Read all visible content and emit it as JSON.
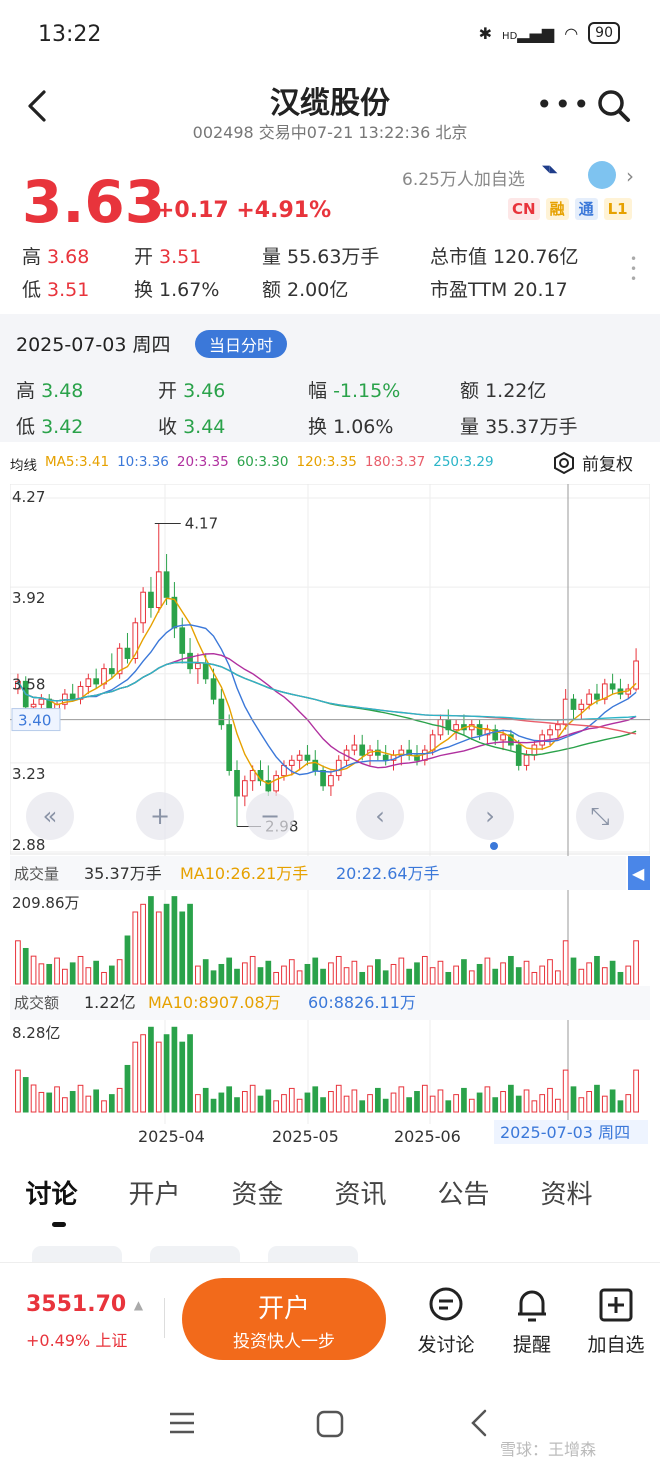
{
  "status_bar": {
    "time": "13:22",
    "network": "HD",
    "battery": "90"
  },
  "header": {
    "title": "汉缆股份",
    "subtitle": "002498 交易中07-21 13:22:36 北京",
    "more_icon": "more-dots-icon",
    "search_icon": "search-icon",
    "back_icon": "back-arrow-icon"
  },
  "quote": {
    "price": "3.63",
    "change": "+0.17 +4.91%",
    "followers": "6.25万人加自选",
    "badges": [
      {
        "label": "CN",
        "color": "#e8343c",
        "bg": "#fde7e7"
      },
      {
        "label": "融",
        "color": "#e6a100",
        "bg": "#fff3d6"
      },
      {
        "label": "通",
        "color": "#3b78d9",
        "bg": "#e5eefb"
      },
      {
        "label": "L1",
        "color": "#e6a100",
        "bg": "#fff3d6"
      }
    ],
    "stats": {
      "high_label": "高",
      "high": "3.68",
      "open_label": "开",
      "open": "3.51",
      "volume_label": "量",
      "volume": "55.63万手",
      "mktcap_label": "总市值",
      "mktcap": "120.76亿",
      "low_label": "低",
      "low": "3.51",
      "turnover_label": "换",
      "turnover": "1.67%",
      "amount_label": "额",
      "amount": "2.00亿",
      "pe_label": "市盈TTM",
      "pe": "20.17"
    }
  },
  "day_card": {
    "date": "2025-07-03 周四",
    "button": "当日分时",
    "high_label": "高",
    "high": "3.48",
    "open_label": "开",
    "open": "3.46",
    "range_label": "幅",
    "range": "-1.15%",
    "amount_label": "额",
    "amount": "1.22亿",
    "low_label": "低",
    "low": "3.42",
    "close_label": "收",
    "close": "3.44",
    "turnover_label": "换",
    "turnover": "1.06%",
    "volume_label": "量",
    "volume": "35.37万手"
  },
  "ma_row": {
    "label": "均线",
    "items": [
      {
        "text": "MA5:3.41",
        "color": "#e6a100"
      },
      {
        "text": "10:3.36",
        "color": "#3b78d9"
      },
      {
        "text": "20:3.35",
        "color": "#b0309f"
      },
      {
        "text": "60:3.30",
        "color": "#2aa24a"
      },
      {
        "text": "120:3.35",
        "color": "#e6a100"
      },
      {
        "text": "180:3.37",
        "color": "#e85d6a"
      },
      {
        "text": "250:3.29",
        "color": "#2bb5c8"
      }
    ],
    "fq_label": "前复权"
  },
  "chart_data": {
    "type": "candlestick",
    "y_ticks": [
      "4.27",
      "3.92",
      "3.58",
      "3.23",
      "2.88"
    ],
    "ylim": [
      2.88,
      4.27
    ],
    "cursor_price": "3.40",
    "max_annotation": "4.17",
    "min_annotation": "2.98",
    "x_ticks": [
      "2025-04",
      "2025-05",
      "2025-06"
    ],
    "cursor_date": "2025-07-03 周四",
    "candles": [
      [
        3.52,
        3.58,
        3.5,
        3.55
      ],
      [
        3.55,
        3.57,
        3.44,
        3.45
      ],
      [
        3.45,
        3.48,
        3.4,
        3.46
      ],
      [
        3.46,
        3.5,
        3.43,
        3.48
      ],
      [
        3.48,
        3.5,
        3.42,
        3.44
      ],
      [
        3.44,
        3.47,
        3.4,
        3.46
      ],
      [
        3.46,
        3.52,
        3.44,
        3.5
      ],
      [
        3.5,
        3.54,
        3.47,
        3.48
      ],
      [
        3.48,
        3.55,
        3.46,
        3.53
      ],
      [
        3.53,
        3.58,
        3.5,
        3.56
      ],
      [
        3.56,
        3.6,
        3.52,
        3.54
      ],
      [
        3.54,
        3.62,
        3.52,
        3.6
      ],
      [
        3.6,
        3.66,
        3.56,
        3.58
      ],
      [
        3.58,
        3.7,
        3.56,
        3.68
      ],
      [
        3.68,
        3.74,
        3.62,
        3.64
      ],
      [
        3.64,
        3.8,
        3.62,
        3.78
      ],
      [
        3.78,
        3.92,
        3.74,
        3.9
      ],
      [
        3.9,
        3.96,
        3.8,
        3.84
      ],
      [
        3.84,
        4.17,
        3.82,
        3.98
      ],
      [
        3.98,
        4.05,
        3.85,
        3.88
      ],
      [
        3.88,
        3.94,
        3.72,
        3.76
      ],
      [
        3.76,
        3.8,
        3.62,
        3.66
      ],
      [
        3.66,
        3.72,
        3.58,
        3.6
      ],
      [
        3.6,
        3.66,
        3.54,
        3.62
      ],
      [
        3.62,
        3.66,
        3.54,
        3.56
      ],
      [
        3.56,
        3.6,
        3.46,
        3.48
      ],
      [
        3.48,
        3.52,
        3.36,
        3.38
      ],
      [
        3.38,
        3.42,
        3.18,
        3.2
      ],
      [
        3.2,
        3.24,
        2.98,
        3.1
      ],
      [
        3.1,
        3.18,
        3.06,
        3.16
      ],
      [
        3.16,
        3.22,
        3.12,
        3.2
      ],
      [
        3.2,
        3.24,
        3.14,
        3.16
      ],
      [
        3.16,
        3.22,
        3.1,
        3.12
      ],
      [
        3.12,
        3.2,
        3.1,
        3.18
      ],
      [
        3.18,
        3.24,
        3.16,
        3.22
      ],
      [
        3.22,
        3.26,
        3.18,
        3.24
      ],
      [
        3.24,
        3.28,
        3.2,
        3.26
      ],
      [
        3.26,
        3.3,
        3.22,
        3.24
      ],
      [
        3.24,
        3.28,
        3.18,
        3.2
      ],
      [
        3.2,
        3.22,
        3.12,
        3.14
      ],
      [
        3.14,
        3.2,
        3.1,
        3.18
      ],
      [
        3.18,
        3.26,
        3.16,
        3.24
      ],
      [
        3.24,
        3.3,
        3.22,
        3.28
      ],
      [
        3.28,
        3.34,
        3.26,
        3.3
      ],
      [
        3.3,
        3.34,
        3.24,
        3.26
      ],
      [
        3.26,
        3.3,
        3.22,
        3.28
      ],
      [
        3.28,
        3.32,
        3.24,
        3.26
      ],
      [
        3.26,
        3.3,
        3.22,
        3.24
      ],
      [
        3.24,
        3.28,
        3.2,
        3.26
      ],
      [
        3.26,
        3.3,
        3.22,
        3.28
      ],
      [
        3.28,
        3.32,
        3.24,
        3.26
      ],
      [
        3.26,
        3.3,
        3.22,
        3.24
      ],
      [
        3.24,
        3.3,
        3.22,
        3.28
      ],
      [
        3.28,
        3.36,
        3.26,
        3.34
      ],
      [
        3.34,
        3.42,
        3.32,
        3.4
      ],
      [
        3.4,
        3.44,
        3.34,
        3.36
      ],
      [
        3.36,
        3.4,
        3.32,
        3.38
      ],
      [
        3.38,
        3.42,
        3.34,
        3.36
      ],
      [
        3.36,
        3.4,
        3.32,
        3.38
      ],
      [
        3.38,
        3.4,
        3.32,
        3.34
      ],
      [
        3.34,
        3.38,
        3.3,
        3.36
      ],
      [
        3.36,
        3.38,
        3.3,
        3.32
      ],
      [
        3.32,
        3.36,
        3.28,
        3.34
      ],
      [
        3.34,
        3.36,
        3.28,
        3.3
      ],
      [
        3.3,
        3.32,
        3.2,
        3.22
      ],
      [
        3.22,
        3.28,
        3.2,
        3.26
      ],
      [
        3.26,
        3.32,
        3.24,
        3.3
      ],
      [
        3.3,
        3.36,
        3.28,
        3.34
      ],
      [
        3.34,
        3.38,
        3.3,
        3.36
      ],
      [
        3.36,
        3.4,
        3.32,
        3.38
      ],
      [
        3.38,
        3.52,
        3.36,
        3.48
      ],
      [
        3.48,
        3.5,
        3.4,
        3.44
      ],
      [
        3.44,
        3.48,
        3.4,
        3.46
      ],
      [
        3.46,
        3.52,
        3.44,
        3.5
      ],
      [
        3.5,
        3.54,
        3.46,
        3.48
      ],
      [
        3.48,
        3.56,
        3.46,
        3.54
      ],
      [
        3.54,
        3.58,
        3.5,
        3.52
      ],
      [
        3.52,
        3.56,
        3.48,
        3.5
      ],
      [
        3.5,
        3.54,
        3.48,
        3.52
      ],
      [
        3.52,
        3.68,
        3.51,
        3.63
      ]
    ]
  },
  "volume_panel": {
    "label": "成交量",
    "value": "35.37万手",
    "ma10": "MA10:26.21万手",
    "ma20": "20:22.64万手",
    "max_tick": "209.86万"
  },
  "amount_panel": {
    "label": "成交额",
    "value": "1.22亿",
    "ma10": "MA10:8907.08万",
    "ma60": "60:8826.11万",
    "max_tick": "8.28亿"
  },
  "tabs": [
    "讨论",
    "开户",
    "资金",
    "资讯",
    "公告",
    "资料"
  ],
  "bottom": {
    "index_value": "3551.70",
    "index_change": "+0.49% 上证",
    "open_button": "开户",
    "open_sub": "投资快人一步",
    "discuss": "发讨论",
    "remind": "提醒",
    "add_watch": "加自选"
  },
  "watermark": "雪球：王增森"
}
